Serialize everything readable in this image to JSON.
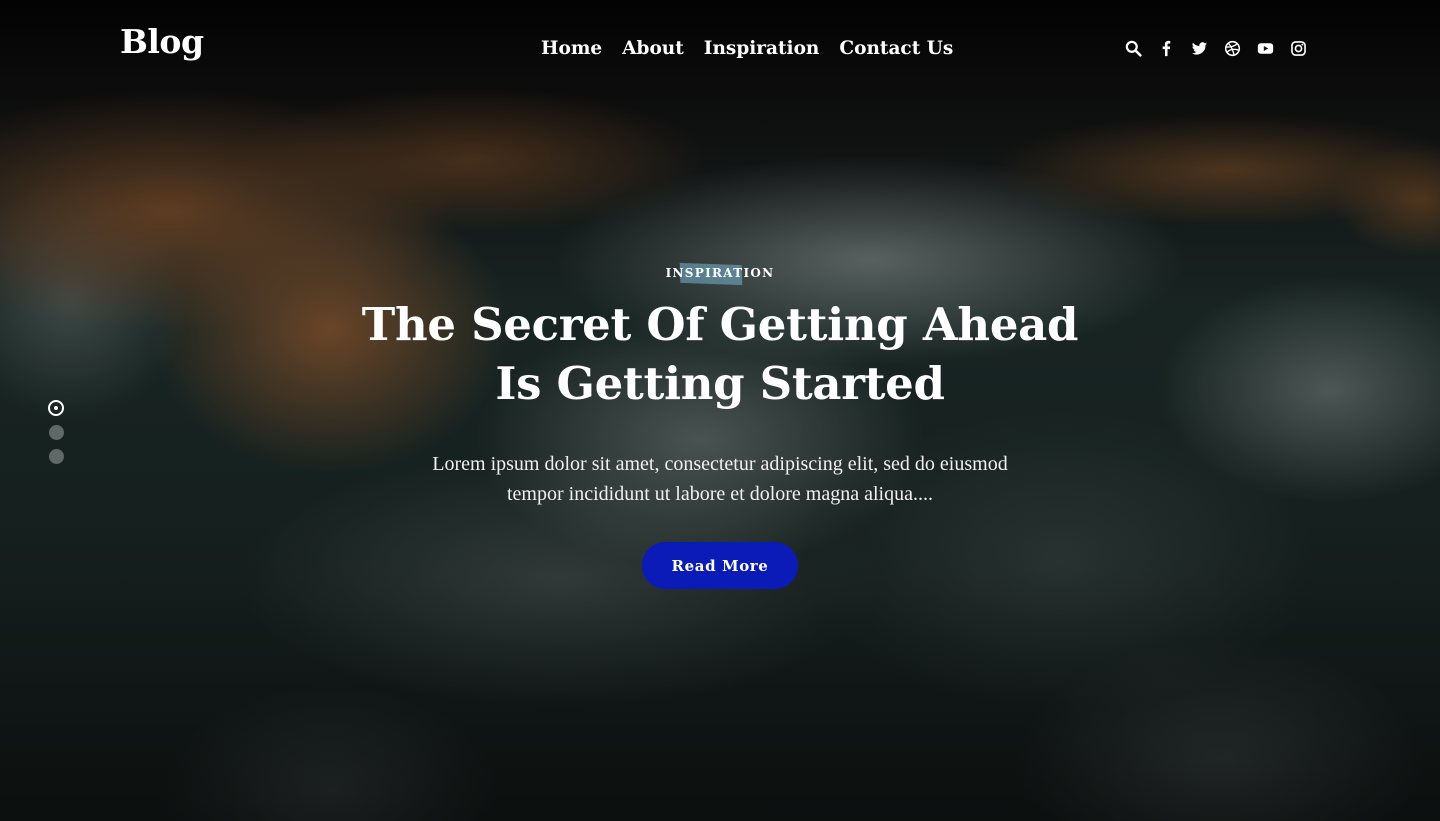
{
  "brand": {
    "logo_text": "Blog"
  },
  "nav": {
    "items": [
      {
        "label": "Home"
      },
      {
        "label": "About"
      },
      {
        "label": "Inspiration"
      },
      {
        "label": "Contact Us"
      }
    ]
  },
  "header_icons": [
    "search-icon",
    "facebook-icon",
    "twitter-icon",
    "dribbble-icon",
    "youtube-icon",
    "instagram-icon"
  ],
  "hero": {
    "category": "INSPIRATION",
    "title_lines": [
      "The Secret Of Getting Ahead",
      "Is Getting Started"
    ],
    "description_lines": [
      "Lorem ipsum dolor sit amet, consectetur adipiscing elit, sed do eiusmod",
      "tempor incididunt ut labore et dolore magna aliqua...."
    ],
    "button_label": "Read More"
  },
  "slider": {
    "total": 3,
    "active_index": 0
  },
  "colors": {
    "button_bg": "#0b1bb8",
    "tag_highlight": "#78b4d2"
  }
}
